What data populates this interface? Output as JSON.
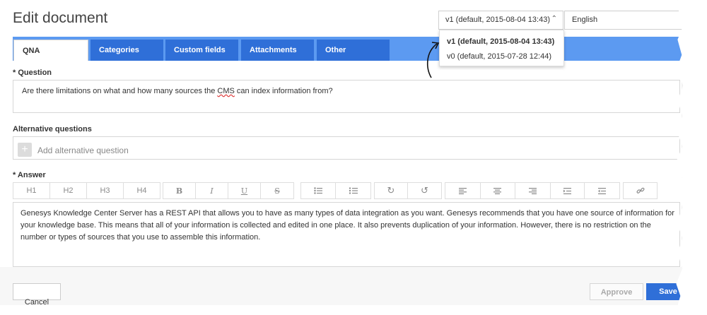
{
  "header": {
    "title": "Edit document",
    "version_selected": "v1 (default, 2015-08-04 13:43)",
    "language_selected": "English"
  },
  "version_dropdown": {
    "options": [
      "v1 (default, 2015-08-04 13:43)",
      "v0 (default, 2015-07-28 12:44)"
    ]
  },
  "tabs": [
    {
      "label": "QNA"
    },
    {
      "label": "Categories"
    },
    {
      "label": "Custom fields"
    },
    {
      "label": "Attachments"
    },
    {
      "label": "Other"
    }
  ],
  "question": {
    "label": "* Question",
    "text_before": "Are there limitations on what and how many sources the ",
    "text_cms": "CMS",
    "text_after": " can index information from?"
  },
  "alternative": {
    "label": "Alternative questions",
    "add_symbol": "+",
    "placeholder": "Add alternative question"
  },
  "answer": {
    "label": "* Answer",
    "text": "Genesys Knowledge Center Server has a REST API that allows you to have as many types of data integration as you want. Genesys recommends that you have one source of information for your knowledge base. This means that all of your information is collected and edited in one place. It also prevents duplication of your information. However, there is no restriction on the number or types of sources that you use to assemble this information."
  },
  "toolbar": {
    "headings": [
      "H1",
      "H2",
      "H3",
      "H4"
    ],
    "formatting": [
      "B",
      "I",
      "U",
      "S"
    ],
    "lists": [
      "bulleted-list-icon",
      "numbered-list-icon"
    ],
    "history": [
      "redo-icon",
      "undo-icon"
    ],
    "alignment": [
      "align-left-icon",
      "align-center-icon",
      "align-right-icon",
      "indent-icon",
      "outdent-icon"
    ],
    "link": [
      "link-icon"
    ]
  },
  "footer": {
    "left_button_partial": "Cancel",
    "approve_label": "Approve",
    "save_label": "Save"
  },
  "colors": {
    "tab_bar": "#5c9af1",
    "tab": "#2f6fd8",
    "primary_button": "#2f6fd8"
  }
}
